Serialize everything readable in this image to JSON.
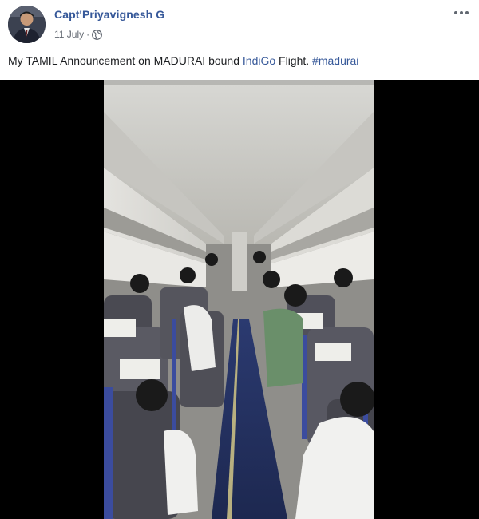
{
  "post": {
    "author": "Capt'Priyavignesh G",
    "date": "11 July",
    "separator": "·",
    "privacy_icon": "globe-icon",
    "more_icon": "more-options-icon",
    "text_parts": {
      "before_brand": "My TAMIL Announcement on MADURAI bound ",
      "brand_link": "IndiGo",
      "after_brand": " Flight. ",
      "hashtag": "#madurai"
    }
  },
  "video": {
    "scene": "aircraft-cabin-interior"
  },
  "colors": {
    "link": "#365899",
    "meta": "#616770",
    "text": "#1c1e21",
    "video_bg": "#000000"
  }
}
